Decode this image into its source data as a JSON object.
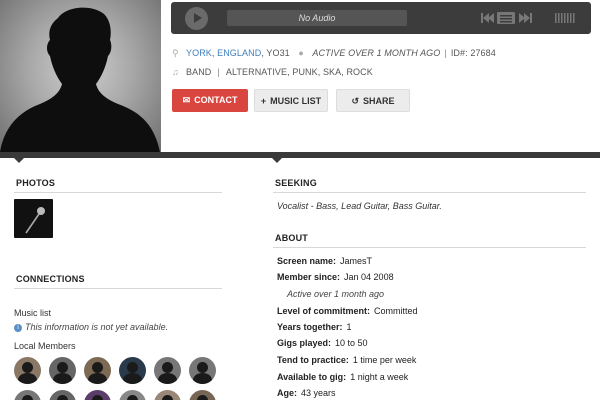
{
  "player": {
    "track": "No Audio"
  },
  "location": {
    "city": "YORK",
    "country": "ENGLAND",
    "postcode": ", YO31",
    "activity": "ACTIVE OVER 1 MONTH AGO",
    "id_label": "ID#: 27684"
  },
  "genres": {
    "type": "BAND",
    "list": "ALTERNATIVE, PUNK, SKA, ROCK"
  },
  "actions": {
    "contact": "CONTACT",
    "music_list": "MUSIC LIST",
    "share": "SHARE"
  },
  "sections": {
    "photos": "PHOTOS",
    "connections": "CONNECTIONS",
    "seeking": "SEEKING",
    "about": "ABOUT"
  },
  "connections": {
    "music_list_label": "Music list",
    "music_list_note": "This information is not yet available.",
    "local_members_label": "Local Members"
  },
  "seeking": {
    "text": "Vocalist - Bass, Lead Guitar, Bass Guitar."
  },
  "about": [
    {
      "key": "Screen name:",
      "value": "JamesT"
    },
    {
      "key": "Member since:",
      "value": "Jan 04 2008"
    },
    {
      "key": "",
      "value": "Active over 1 month ago"
    },
    {
      "key": "Level of commitment:",
      "value": "Committed"
    },
    {
      "key": "Years together:",
      "value": "1"
    },
    {
      "key": "Gigs played:",
      "value": "10 to 50"
    },
    {
      "key": "Tend to practice:",
      "value": "1 time per week"
    },
    {
      "key": "Available to gig:",
      "value": "1 night a week"
    },
    {
      "key": "Age:",
      "value": "43 years"
    }
  ],
  "colors": {
    "accent_red": "#d9453f",
    "link_blue": "#3f7fbf",
    "dark_bar": "#3a3a3a"
  }
}
